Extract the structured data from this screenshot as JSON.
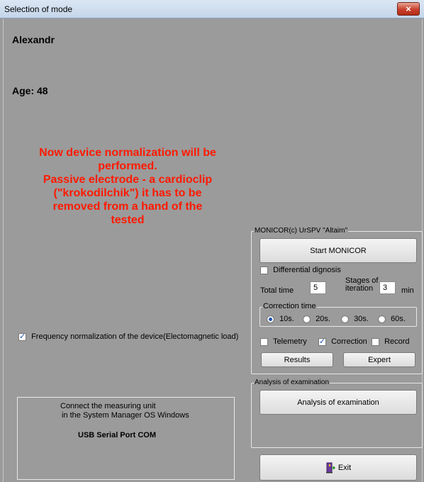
{
  "window": {
    "title": "Selection of mode",
    "close_glyph": "×"
  },
  "patient": {
    "name": "Alexandr",
    "age_label": "Age: 48"
  },
  "warning": {
    "lines": [
      "Now device normalization will be",
      "performed.",
      "Passive electrode - a cardioclip",
      "(\"krokodilchik\") it has to be",
      "removed from a hand of the",
      "tested"
    ],
    "color": "#ff1a00"
  },
  "frequency_normalization": {
    "label": "Frequency normalization of the device(Electomagnetic load)",
    "checked": true
  },
  "info_box": {
    "line1": "Connect the measuring unit",
    "line2": "in the System Manager OS Windows",
    "line3": "USB Serial Port COM"
  },
  "monicor": {
    "group_title": "MONICOR(c) UrSPV \"Altaim\"",
    "start_button": "Start MONICOR",
    "differential": {
      "label": "Differential dignosis",
      "checked": false
    },
    "total_time_label": "Total time",
    "total_time_value": "5",
    "stages_label_1": "Stages of",
    "stages_label_2": "iteration",
    "stages_value": "3",
    "min_label": "min",
    "correction_time": {
      "title": "Correction time",
      "options": [
        "10s.",
        "20s.",
        "30s.",
        "60s."
      ],
      "selected": "10s."
    },
    "telemetry": {
      "label": "Telemetry",
      "checked": false
    },
    "correction": {
      "label": "Correction",
      "checked": true
    },
    "record": {
      "label": "Record",
      "checked": false
    },
    "results_button": "Results",
    "expert_button": "Expert"
  },
  "analysis": {
    "group_title": "Analysis of examination",
    "button": "Analysis of examination"
  },
  "exit_button": {
    "label": "Exit",
    "icon": "exit-door-icon"
  }
}
